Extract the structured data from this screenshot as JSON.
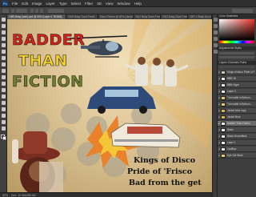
{
  "menubar": {
    "app_logo": "Ps",
    "items": [
      "File",
      "Edit",
      "Image",
      "Layer",
      "Type",
      "Select",
      "Filter",
      "3D",
      "View",
      "Window",
      "Help"
    ]
  },
  "tabs": [
    {
      "label": "1985 Bday (web).psd @ 50% (Layer 0, RGB/8)"
    },
    {
      "label": "2005 Bday Good Freed..."
    },
    {
      "label": "Disco Freeze @ 50% (Jacket..."
    },
    {
      "label": "2001 Bday Good Freed..."
    },
    {
      "label": "2003 Bday Good Freed..."
    },
    {
      "label": "1997 2 Bday Good..."
    }
  ],
  "active_tab_index": 0,
  "poster": {
    "headline_line1": "BADDER",
    "headline_line2": "THAN",
    "headline_line3": "FICTION",
    "caption_line1": "Kings of Disco",
    "caption_line2": "Pride of 'Frisco",
    "caption_line3": "Bad from the get"
  },
  "statusbar": {
    "zoom": "50%",
    "doc_info": "Doc: 10.3M/285.0M"
  },
  "panels": {
    "color_header": "Color  Swatches",
    "adjust_header": "Adjustments  Styles",
    "layers_header": "Layers  Channels  Paths"
  },
  "layers": [
    {
      "name": "Kings of disco Pride of Frisco",
      "selected": false,
      "color": "#cfc6b1"
    },
    {
      "name": "BBB 16",
      "selected": false,
      "color": "#e9e9e9"
    },
    {
      "name": "BBB Hype",
      "selected": false,
      "color": "#e9e9e9"
    },
    {
      "name": "Layer 3",
      "selected": false,
      "color": "#e9e9e9"
    },
    {
      "name": "The battle in Bottom...",
      "selected": false,
      "color": "#e5c96a"
    },
    {
      "name": "The battle in Bottom...",
      "selected": false,
      "color": "#e5c96a"
    },
    {
      "name": "Jacket blue copy",
      "selected": false,
      "color": "#d9b34a"
    },
    {
      "name": "Jacket Blue",
      "selected": false,
      "color": "#d9b34a"
    },
    {
      "name": "Badder Than Fiction",
      "selected": true,
      "color": "#e9e9e9"
    },
    {
      "name": "Black",
      "selected": false,
      "color": "#e9e9e9"
    },
    {
      "name": "Black Growsftbck",
      "selected": false,
      "color": "#e9e9e9"
    },
    {
      "name": "Layer 1",
      "selected": false,
      "color": "#e9e9e9"
    },
    {
      "name": "Cadillac",
      "selected": false,
      "color": "#e9e9e9"
    },
    {
      "name": "Eye Car Blast",
      "selected": false,
      "color": "#e5c96a"
    }
  ],
  "colors": {
    "chrome": "#3a3a3a",
    "headline_red": "#d8211b",
    "headline_yellow": "#f2d12a",
    "headline_olive": "#6e7e2a",
    "paper": "#dcc395"
  }
}
